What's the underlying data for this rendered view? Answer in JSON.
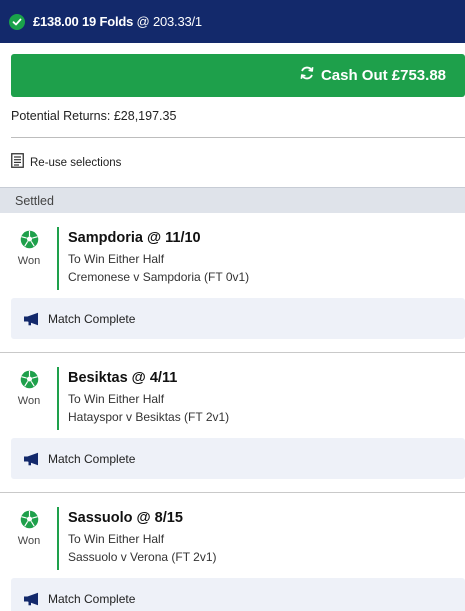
{
  "header": {
    "stake_label": "£138.00 19 Folds",
    "odds_label": " @ 203.33/1",
    "icon": "check-circle-icon"
  },
  "cashout": {
    "label": "Cash Out £753.88",
    "icon": "refresh-icon",
    "color": "#1ea04b"
  },
  "returns": {
    "label": "Potential Returns: £28,197.35"
  },
  "reuse": {
    "label": "Re-use selections",
    "icon": "document-icon"
  },
  "settled": {
    "label": "Settled"
  },
  "legs": [
    {
      "status": "Won",
      "selection": "Sampdoria @ 11/10",
      "market": "To Win Either Half",
      "event": "Cremonese v Sampdoria (FT 0v1)",
      "state": "Match Complete"
    },
    {
      "status": "Won",
      "selection": "Besiktas @ 4/11",
      "market": "To Win Either Half",
      "event": "Hatayspor v Besiktas (FT 2v1)",
      "state": "Match Complete"
    },
    {
      "status": "Won",
      "selection": "Sassuolo @ 8/15",
      "market": "To Win Either Half",
      "event": "Sassuolo v Verona (FT 2v1)",
      "state": "Match Complete"
    }
  ],
  "colors": {
    "header_bg": "#13296b",
    "won_green": "#1ea04b"
  }
}
